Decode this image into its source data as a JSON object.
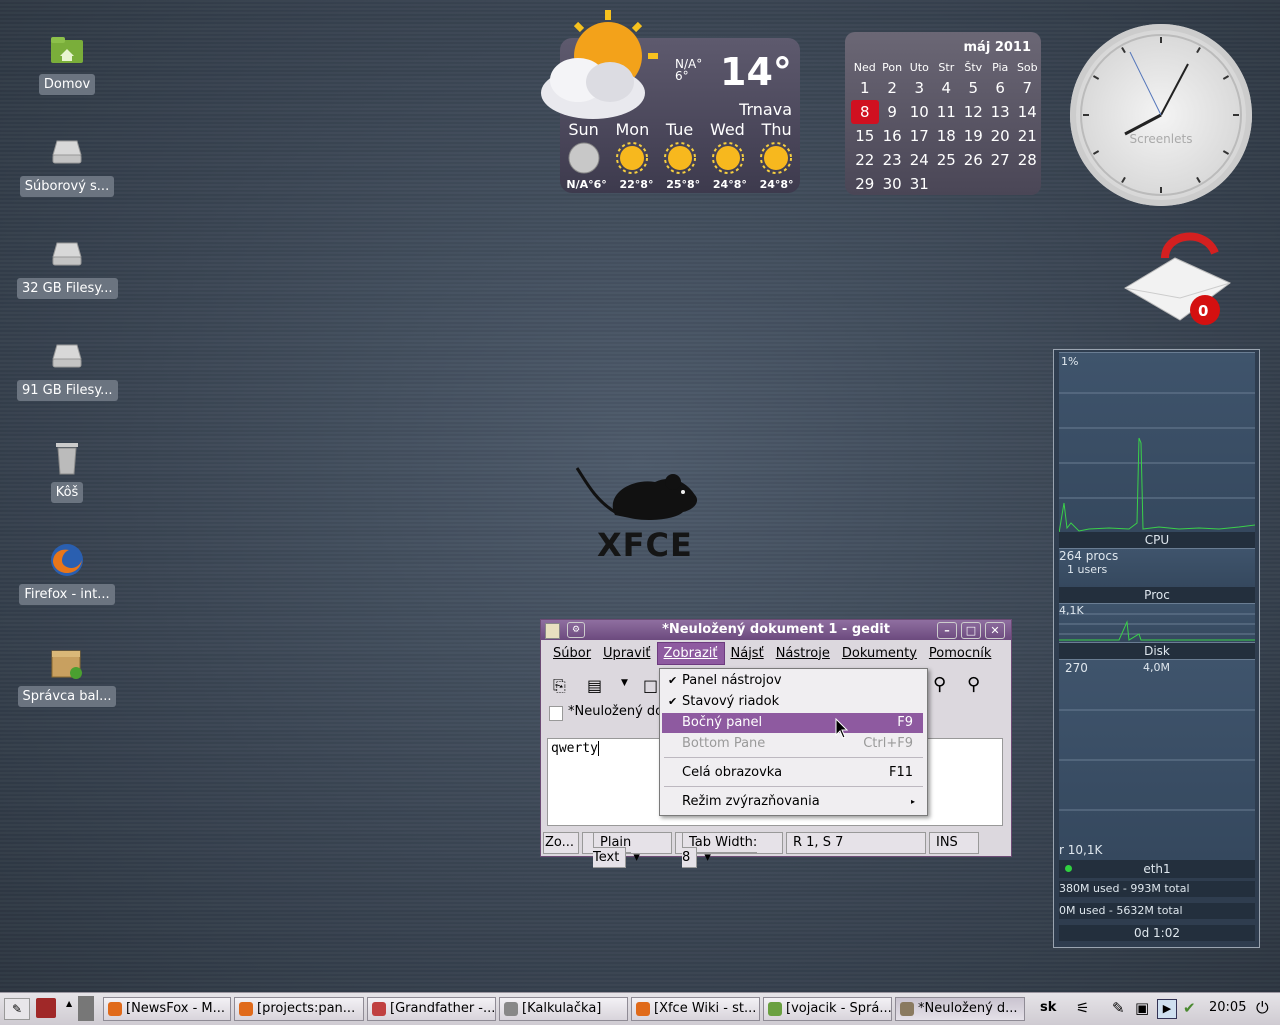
{
  "desktop": {
    "icons": [
      {
        "label": "Domov",
        "icon": "home-folder-icon"
      },
      {
        "label": "Súborový s...",
        "icon": "drive-icon"
      },
      {
        "label": "32 GB Filesy...",
        "icon": "drive-icon"
      },
      {
        "label": "91 GB Filesy...",
        "icon": "drive-icon"
      },
      {
        "label": "Kôš",
        "icon": "trash-icon"
      },
      {
        "label": "Firefox - int...",
        "icon": "firefox-icon"
      },
      {
        "label": "Správca bal...",
        "icon": "package-manager-icon"
      }
    ],
    "logo_text": "XFCE"
  },
  "weather": {
    "current_na": "N/A°",
    "current_low": "6°",
    "temp": "14°",
    "city": "Trnava",
    "days": [
      "Sun",
      "Mon",
      "Tue",
      "Wed",
      "Thu"
    ],
    "forecast": [
      "N/A°6°",
      "22°8°",
      "25°8°",
      "24°8°",
      "24°8°"
    ]
  },
  "calendar": {
    "month": "máj 2011",
    "weekdays": [
      "Ned",
      "Pon",
      "Uto",
      "Str",
      "Štv",
      "Pia",
      "Sob"
    ],
    "weeks": [
      [
        "1",
        "2",
        "3",
        "4",
        "5",
        "6",
        "7"
      ],
      [
        "8",
        "9",
        "10",
        "11",
        "12",
        "13",
        "14"
      ],
      [
        "15",
        "16",
        "17",
        "18",
        "19",
        "20",
        "21"
      ],
      [
        "22",
        "23",
        "24",
        "25",
        "26",
        "27",
        "28"
      ],
      [
        "29",
        "30",
        "31",
        "",
        "",
        "",
        ""
      ]
    ],
    "today": "8"
  },
  "clock": {
    "brand": "Screenlets"
  },
  "mail": {
    "count": "0"
  },
  "gedit": {
    "title": "*Neuložený dokument 1 - gedit",
    "menus": [
      "Súbor",
      "Upraviť",
      "Zobraziť",
      "Nájsť",
      "Nástroje",
      "Dokumenty",
      "Pomocník"
    ],
    "tab": "*Neuložený do",
    "text": "qwerty",
    "status": {
      "left": "Zo...",
      "lang": "Plain Text",
      "tabwidth": "Tab Width: 8",
      "pos": "R 1, S 7",
      "mode": "INS"
    }
  },
  "view_menu": {
    "items": [
      {
        "label": "Panel nástrojov",
        "checked": true,
        "key": ""
      },
      {
        "label": "Stavový riadok",
        "checked": true,
        "key": ""
      },
      {
        "label": "Bočný panel",
        "checked": false,
        "key": "F9"
      },
      {
        "label": "Bottom Pane",
        "checked": false,
        "key": "Ctrl+F9"
      },
      {
        "label": "Celá obrazovka",
        "checked": false,
        "key": "F11"
      },
      {
        "label": "Režim zvýrazňovania",
        "checked": false,
        "key": ""
      }
    ]
  },
  "monitor": {
    "cpu_pct": "1%",
    "cpu_label": "CPU",
    "procs": "264 procs",
    "users": "1 users",
    "proc_label": "Proc",
    "disk_val": "4,1K",
    "disk_label": "Disk",
    "net_top_left": "270",
    "net_top_right": "4,0M",
    "net_bottom": "r 10,1K",
    "net_label": "eth1",
    "mem": "380M used - 993M total",
    "swap": "0M used - 5632M total",
    "uptime": "0d  1:02"
  },
  "taskbar": {
    "tasks": [
      {
        "label": "[NewsFox - M...",
        "color": "#e06a1a"
      },
      {
        "label": "[projects:pan...",
        "color": "#e06a1a"
      },
      {
        "label": "[Grandfather -...",
        "color": "#c04040"
      },
      {
        "label": "[Kalkulačka]",
        "color": "#888888"
      },
      {
        "label": "[Xfce Wiki - st...",
        "color": "#e06a1a"
      },
      {
        "label": "[vojacik - Sprá...",
        "color": "#6aa040"
      },
      {
        "label": "*Neuložený d...",
        "color": "#8a7a60"
      }
    ],
    "lang": "sk",
    "time": "20:05"
  }
}
